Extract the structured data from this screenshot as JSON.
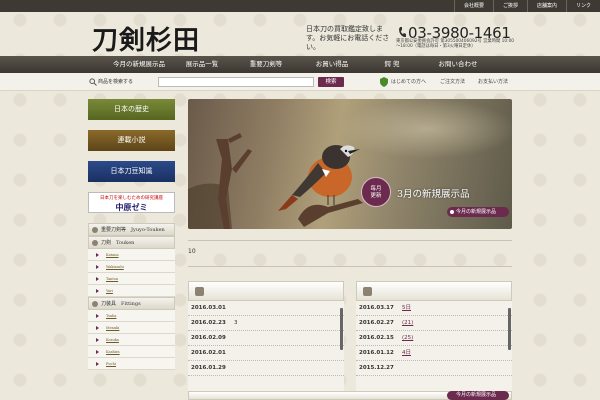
{
  "toplinks": [
    "会社概要",
    "ご挨拶",
    "店舗案内",
    "リンク"
  ],
  "logo": "刀剣杉田",
  "tagline": "日本刀の買取鑑定致します。お気軽にお電話ください。",
  "phone": "03-3980-1461",
  "phone_sub": "東京都公安委員会許可 第305500406092号 営業時間 10:00～18:00（電話は毎日・第3火曜日定休）",
  "nav": [
    "今月の新規展示品",
    "展示品一覧",
    "重要刀剣等",
    "お買い得品",
    "鍔 兜",
    "お問い合わせ"
  ],
  "search": {
    "label": "商品を検索する",
    "button": "検索",
    "first_visit": "はじめての方へ",
    "order": "ご注文方法",
    "payment": "お支払い方法"
  },
  "sidebar": {
    "banners": [
      "日本の歴史",
      "連載小説",
      "日本刀豆知識"
    ],
    "zemi_top": "日本刀を楽しむための研究講座",
    "zemi_name": "中原ゼミ",
    "sections": [
      {
        "title": "重要刀剣等　Jyuyo-Touken",
        "items": []
      },
      {
        "title": "刀剣　Touken",
        "items": [
          "Katana",
          "Wakizashi",
          "Tantou",
          "Yari"
        ]
      },
      {
        "title": "刀装具　Fittings",
        "items": [
          "Tsuba",
          "Menuki",
          "Kozuka",
          "Kashira",
          "Fuchi"
        ]
      }
    ]
  },
  "hero": {
    "badge1": "毎月",
    "badge2": "更新",
    "title": "3月の新規展示品",
    "button": "今月の新規展示品"
  },
  "ticker": "10",
  "panels": {
    "left": [
      {
        "date": "2016.03.01",
        "desc": ""
      },
      {
        "date": "2016.02.23",
        "desc": "3"
      },
      {
        "date": "2016.02.09",
        "desc": ""
      },
      {
        "date": "2016.02.01",
        "desc": ""
      },
      {
        "date": "2016.01.29",
        "desc": ""
      }
    ],
    "right": [
      {
        "date": "2016.03.17",
        "desc": "5日"
      },
      {
        "date": "2016.02.27",
        "desc": "(21)"
      },
      {
        "date": "2016.02.15",
        "desc": "(25)"
      },
      {
        "date": "2016.01.12",
        "desc": "4日"
      },
      {
        "date": "2015.12.27",
        "desc": ""
      }
    ]
  },
  "bottom_button": "今月の新規展示品"
}
